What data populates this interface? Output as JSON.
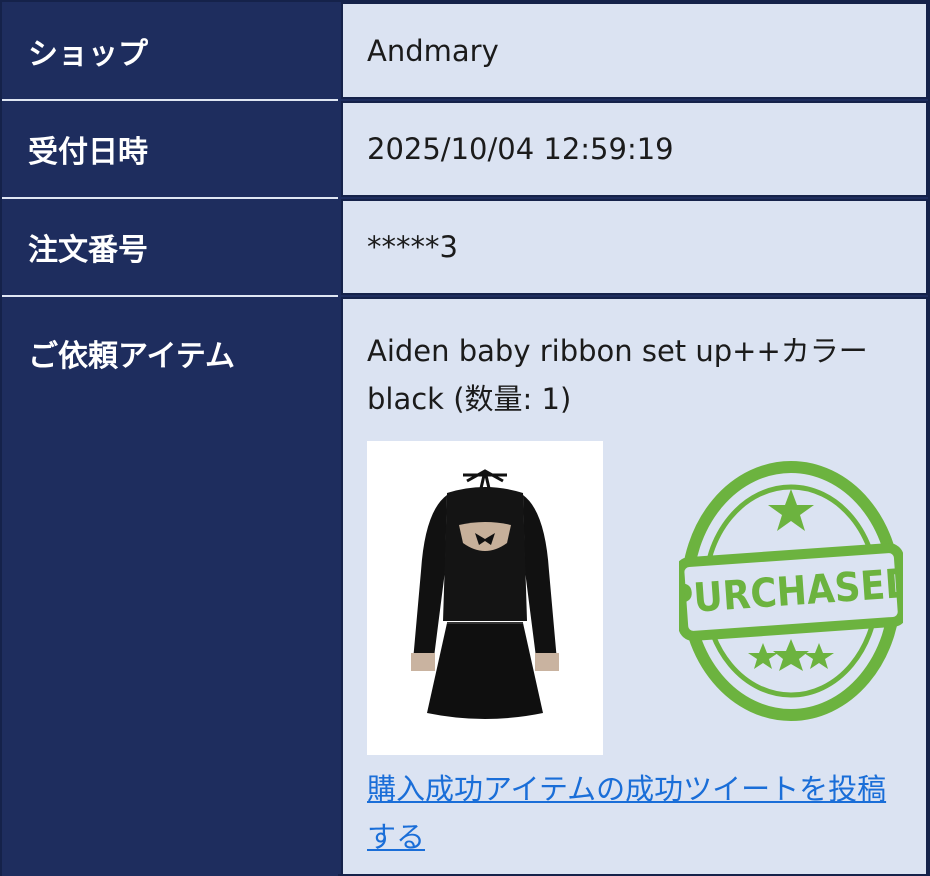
{
  "rows": {
    "shop": {
      "label": "ショップ",
      "value": "Andmary"
    },
    "received": {
      "label": "受付日時",
      "value": "2025/10/04 12:59:19"
    },
    "order": {
      "label": "注文番号",
      "value": "*****3"
    },
    "item": {
      "label": "ご依頼アイテム",
      "value": "Aiden baby ribbon set up++カラーblack (数量: 1)",
      "image_icon": "black-dress-product-photo",
      "stamp_text": "PURCHASED",
      "stamp_icon": "star-icon",
      "link_text": "購入成功アイテムの成功ツイートを投稿する"
    }
  },
  "colors": {
    "header_bg": "#1e2d5e",
    "cell_bg": "#dbe3f2",
    "link": "#1a6ed8",
    "stamp": "#6cb33f"
  }
}
